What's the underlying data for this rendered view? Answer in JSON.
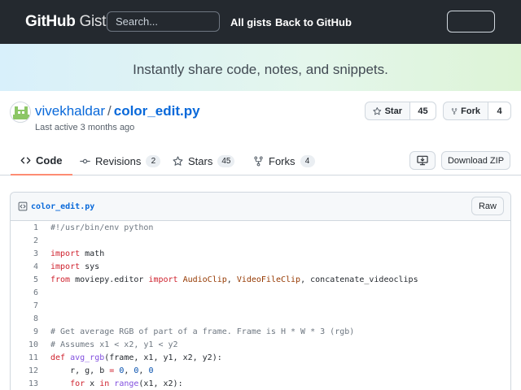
{
  "header": {
    "logo_bold": "GitHub",
    "logo_light": "Gist",
    "search_placeholder": "Search...",
    "nav": [
      "All gists",
      "Back to GitHub"
    ]
  },
  "banner": {
    "text": "Instantly share code, notes, and snippets."
  },
  "gist": {
    "owner": "vivekhaldar",
    "separator": "/",
    "name": "color_edit.py",
    "last_active": "Last active 3 months ago",
    "star_label": "Star",
    "star_count": "45",
    "fork_label": "Fork",
    "fork_count": "4"
  },
  "tabs": [
    {
      "label": "Code",
      "count": "",
      "icon": "code-icon"
    },
    {
      "label": "Revisions",
      "count": "2",
      "icon": "commit-icon"
    },
    {
      "label": "Stars",
      "count": "45",
      "icon": "star-icon"
    },
    {
      "label": "Forks",
      "count": "4",
      "icon": "fork-icon"
    }
  ],
  "actions": {
    "download_zip": "Download ZIP",
    "embed_icon": "desktop-download-icon"
  },
  "file": {
    "name": "color_edit.py",
    "raw_label": "Raw",
    "lines": [
      {
        "n": "1",
        "tokens": [
          [
            "c",
            "#!/usr/bin/env python"
          ]
        ]
      },
      {
        "n": "2",
        "tokens": []
      },
      {
        "n": "3",
        "tokens": [
          [
            "k",
            "import"
          ],
          [
            "",
            " math"
          ]
        ]
      },
      {
        "n": "4",
        "tokens": [
          [
            "k",
            "import"
          ],
          [
            "",
            " sys"
          ]
        ]
      },
      {
        "n": "5",
        "tokens": [
          [
            "k",
            "from"
          ],
          [
            "",
            " moviepy.editor "
          ],
          [
            "k",
            "import"
          ],
          [
            "",
            " "
          ],
          [
            "m",
            "AudioClip"
          ],
          [
            "",
            ", "
          ],
          [
            "m",
            "VideoFileClip"
          ],
          [
            "",
            ", concatenate_videoclips"
          ]
        ]
      },
      {
        "n": "6",
        "tokens": []
      },
      {
        "n": "7",
        "tokens": []
      },
      {
        "n": "8",
        "tokens": []
      },
      {
        "n": "9",
        "tokens": [
          [
            "c",
            "# Get average RGB of part of a frame. Frame is H * W * 3 (rgb)"
          ]
        ]
      },
      {
        "n": "10",
        "tokens": [
          [
            "c",
            "# Assumes x1 < x2, y1 < y2"
          ]
        ]
      },
      {
        "n": "11",
        "tokens": [
          [
            "k",
            "def"
          ],
          [
            "",
            " "
          ],
          [
            "f",
            "avg_rgb"
          ],
          [
            "",
            "(frame, x1, y1, x2, y2):"
          ]
        ]
      },
      {
        "n": "12",
        "tokens": [
          [
            "",
            "    r, g, b "
          ],
          [
            "k",
            "="
          ],
          [
            "",
            " "
          ],
          [
            "n",
            "0"
          ],
          [
            "",
            ", "
          ],
          [
            "n",
            "0"
          ],
          [
            "",
            ", "
          ],
          [
            "n",
            "0"
          ]
        ]
      },
      {
        "n": "13",
        "tokens": [
          [
            "",
            "    "
          ],
          [
            "k",
            "for"
          ],
          [
            "",
            " x "
          ],
          [
            "k",
            "in"
          ],
          [
            "",
            " "
          ],
          [
            "f",
            "range"
          ],
          [
            "",
            "(x1, x2):"
          ]
        ]
      }
    ]
  }
}
